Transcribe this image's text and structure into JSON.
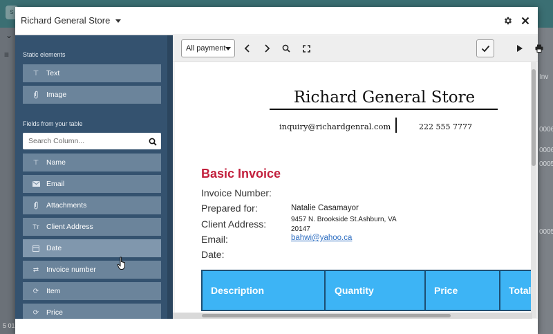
{
  "background": {
    "bottom_text": "5 01",
    "right_column_cells": [
      "Inv",
      "0006",
      "0006",
      "0005",
      "0005"
    ]
  },
  "modal": {
    "title": "Richard General Store",
    "header_icons": [
      "gear-icon",
      "close-icon"
    ]
  },
  "sidebar": {
    "static_heading": "Static elements",
    "static_items": [
      {
        "label": "Text",
        "icon": "text-icon"
      },
      {
        "label": "Image",
        "icon": "paperclip-icon"
      }
    ],
    "fields_heading": "Fields from your table",
    "search_placeholder": "Search Column...",
    "field_items": [
      {
        "label": "Name",
        "icon": "text-icon"
      },
      {
        "label": "Email",
        "icon": "envelope-icon"
      },
      {
        "label": "Attachments",
        "icon": "paperclip-icon"
      },
      {
        "label": "Client Address",
        "icon": "long-text-icon"
      },
      {
        "label": "Date",
        "icon": "calendar-icon"
      },
      {
        "label": "Invoice number",
        "icon": "link-arrows-icon"
      },
      {
        "label": "Item",
        "icon": "sync-icon"
      },
      {
        "label": "Price",
        "icon": "sync-icon"
      }
    ]
  },
  "toolbar": {
    "filter_value": "All payment"
  },
  "invoice": {
    "store_name": "Richard General Store",
    "email": "inquiry@richardgenral.com",
    "phone": "222 555 7777",
    "title": "Basic Invoice",
    "labels": {
      "invoice_number": "Invoice Number:",
      "prepared_for": "Prepared for:",
      "client_address": "Client Address:",
      "email": "Email:",
      "date": "Date:"
    },
    "values": {
      "prepared_for": "Natalie Casamayor",
      "client_address": "9457 N. Brookside St.Ashburn, VA 20147",
      "email": "bahwi@yahoo.ca"
    },
    "table_headers": [
      "Description",
      "Quantity",
      "Price",
      "Total"
    ],
    "colors": {
      "title": "#c21f3c",
      "table_header": "#3db4f5"
    }
  }
}
